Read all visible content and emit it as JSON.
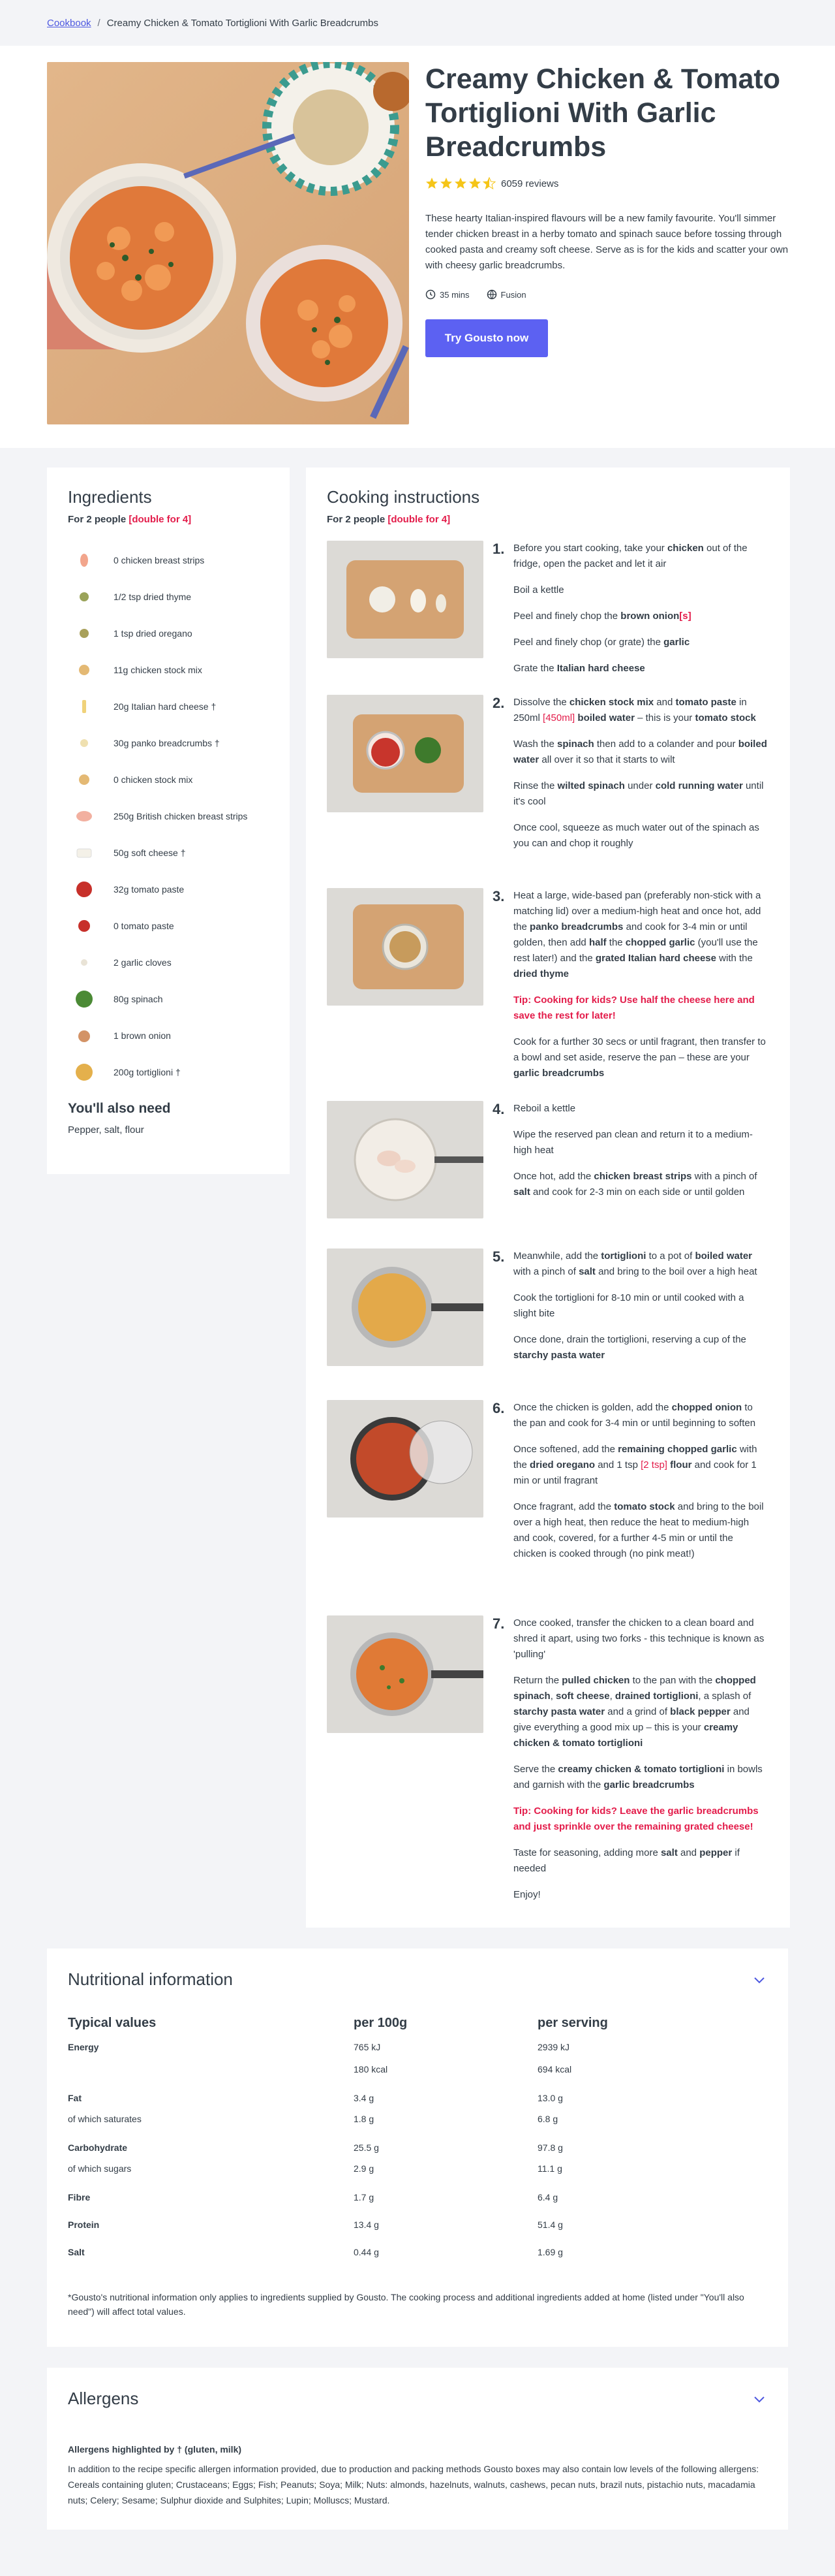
{
  "breadcrumb": {
    "root": "Cookbook",
    "current": "Creamy Chicken & Tomato Tortiglioni With Garlic Breadcrumbs"
  },
  "recipe": {
    "title": "Creamy Chicken & Tomato Tortiglioni With Garlic Breadcrumbs",
    "rating": 4.5,
    "reviews": "6059 reviews",
    "description": "These hearty Italian-inspired flavours will be a new family favourite. You'll simmer tender chicken breast in a herby tomato and spinach sauce before tossing through cooked pasta and creamy soft cheese. Serve as is for the kids and scatter your own with cheesy garlic breadcrumbs.",
    "time": "35 mins",
    "cuisine": "Fusion",
    "cta": "Try Gousto now"
  },
  "ingredients": {
    "title": "Ingredients",
    "people": "For 2 people",
    "double": "[double for 4]",
    "items": [
      "0 chicken breast strips",
      "1/2 tsp dried thyme",
      "1 tsp dried oregano",
      "11g chicken stock mix",
      "20g Italian hard cheese †",
      "30g panko breadcrumbs †",
      "0 chicken stock mix",
      "250g British chicken breast strips",
      "50g soft cheese †",
      "32g tomato paste",
      "0 tomato paste",
      "2 garlic cloves",
      "80g spinach",
      "1 brown onion",
      "200g tortiglioni †"
    ],
    "also_title": "You'll also need",
    "also_text": "Pepper, salt, flour"
  },
  "cooking": {
    "title": "Cooking instructions",
    "people": "For 2 people",
    "double": "[double for 4]"
  },
  "nutrition": {
    "title": "Nutritional information",
    "headers": [
      "Typical values",
      "per 100g",
      "per serving"
    ],
    "energy_label": "Energy",
    "energy_100_kj": "765 kJ",
    "energy_100_kcal": "180 kcal",
    "energy_serv_kj": "2939 kJ",
    "energy_serv_kcal": "694 kcal",
    "fat": [
      "Fat",
      "3.4 g",
      "13.0 g"
    ],
    "sat": [
      "of which saturates",
      "1.8 g",
      "6.8 g"
    ],
    "carb": [
      "Carbohydrate",
      "25.5 g",
      "97.8 g"
    ],
    "sugar": [
      "of which sugars",
      "2.9 g",
      "11.1 g"
    ],
    "fibre": [
      "Fibre",
      "1.7 g",
      "6.4 g"
    ],
    "protein": [
      "Protein",
      "13.4 g",
      "51.4 g"
    ],
    "salt": [
      "Salt",
      "0.44 g",
      "1.69 g"
    ],
    "footnote": "*Gousto's nutritional information only applies to ingredients supplied by Gousto. The cooking process and additional ingredients added at home (listed under \"You'll also need\") will affect total values."
  },
  "allergens": {
    "title": "Allergens",
    "subtitle": "Allergens highlighted by † (gluten, milk)",
    "text": "In addition to the recipe specific allergen information provided, due to production and packing methods Gousto boxes may also contain low levels of the following allergens: Cereals containing gluten; Crustaceans; Eggs; Fish; Peanuts; Soya; Milk; Nuts: almonds, hazelnuts, walnuts, cashews, pecan nuts, brazil nuts, pistachio nuts, macadamia nuts; Celery; Sesame; Sulphur dioxide and Sulphites; Lupin; Molluscs; Mustard."
  },
  "colors": {
    "accent": "#5c61f2",
    "link": "#4d58e0",
    "red": "#e31c4a",
    "star": "#f5c518"
  }
}
